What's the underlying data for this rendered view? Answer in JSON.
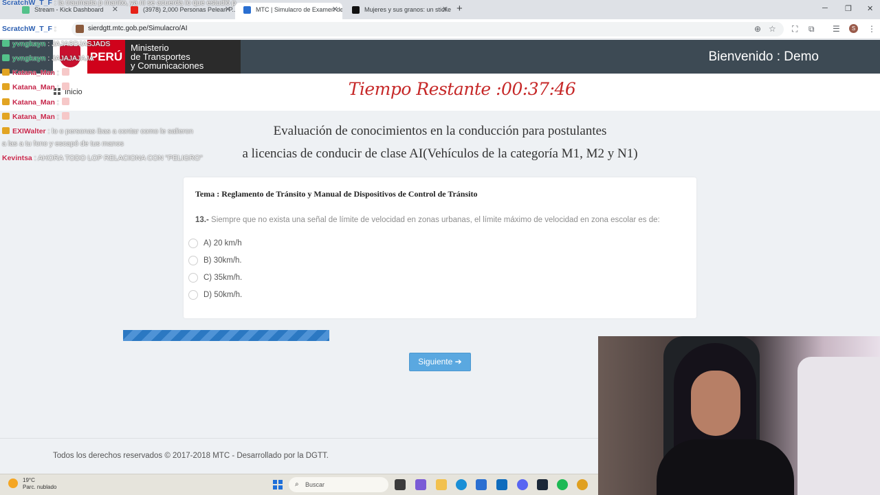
{
  "browser": {
    "tabs": [
      {
        "label": "Stream - Kick Dashboard",
        "active": false
      },
      {
        "label": "(3978) 2,000 Personas Pelean P...",
        "active": false
      },
      {
        "label": "MTC | Simulacro de Examen de",
        "active": true
      },
      {
        "label": "Mujeres y sus granos: un sticke",
        "active": false
      }
    ],
    "url": "sierdgtt.mtc.gob.pe/Simulacro/AI"
  },
  "header": {
    "logo_peru": "PERÚ",
    "ministry_line1": "Ministerio",
    "ministry_line2": "de Transportes",
    "ministry_line3": "y Comunicaciones",
    "welcome": "Bienvenido : Demo"
  },
  "nav": {
    "inicio": "Inicio"
  },
  "timer": {
    "text": "Tiempo Restante :00:37:46"
  },
  "exam": {
    "title_line1": "Evaluación de conocimientos en la conducción para postulantes",
    "title_line2": "a licencias de conducir de clase AI(Vehículos de la categoría M1, M2 y N1)"
  },
  "question": {
    "tema": "Tema : Reglamento de Tránsito y Manual de Dispositivos de Control de Tránsito",
    "number": "13.-",
    "text": "Siempre que no exista una señal de límite de velocidad en zonas urbanas, el límite máximo de velocidad en zona escolar es de:",
    "options": [
      "A) 20 km/h",
      "B) 30km/h.",
      "C) 35km/h.",
      "D) 50km/h."
    ]
  },
  "progress": {
    "value_percent": 37
  },
  "buttons": {
    "next": "Siguiente"
  },
  "footer": {
    "text": "Todos los derechos reservados © 2017-2018 MTC - Desarrollado por la DGTT."
  },
  "taskbar": {
    "temperature": "19°C",
    "weather": "Parc. nublado",
    "search_placeholder": "Buscar"
  },
  "chat": [
    {
      "user": "ScratchW_T_F",
      "msg": ": la traumada p manito, ya ni se acuerda lo que estudió p"
    },
    {
      "user": "ScratchW_T_F",
      "msg": ":"
    },
    {
      "user": "yvngkayn",
      "msg": ": JAJASDJASJADS"
    },
    {
      "user": "yvngkayn",
      "msg": ": JAJAJAJAJA"
    },
    {
      "user": "Katana_Man",
      "msg": ":"
    },
    {
      "user": "Katana_Man",
      "msg": ":"
    },
    {
      "user": "Katana_Man",
      "msg": ":"
    },
    {
      "user": "Katana_Man",
      "msg": ":"
    },
    {
      "user": "EXIWalter",
      "msg": ": lo o personas ibas a contar como le salieron"
    },
    {
      "user": "",
      "msg": "a las a tu fono y escapó de tus manos"
    },
    {
      "user": "Kevintsa",
      "msg": ": AHORA TODO LOP RELACIONA CON \"PELIGRO\""
    }
  ],
  "colors": {
    "header_bg": "#3d4a54",
    "timer_red": "#c62828",
    "button_blue": "#5aa8e0",
    "progress_blue": "#2b78c2"
  }
}
